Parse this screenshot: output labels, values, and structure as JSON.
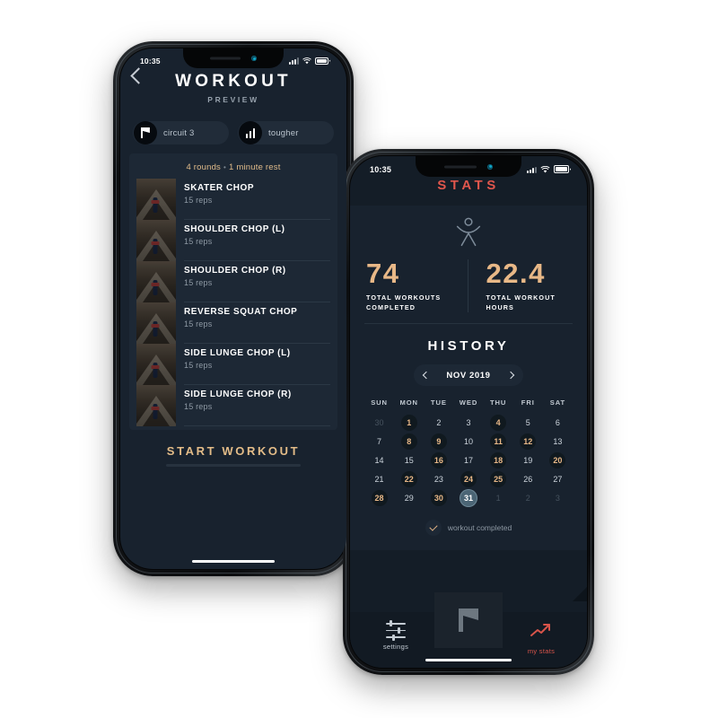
{
  "phone_workout": {
    "status_bar": {
      "time": "10:35",
      "signal_icon": "signal-bars-icon",
      "wifi_icon": "wifi-icon",
      "battery_icon": "battery-icon"
    },
    "back_icon": "back-chevron-icon",
    "title": "WORKOUT",
    "subtitle": "PREVIEW",
    "pills": [
      {
        "icon": "flag-icon",
        "label": "circuit 3"
      },
      {
        "icon": "bar-chart-icon",
        "label": "tougher"
      }
    ],
    "rounds_line": {
      "rounds": "4 rounds",
      "separator": "•",
      "rest": "1 minute rest"
    },
    "exercises": [
      {
        "name": "SKATER CHOP",
        "reps": "15 reps",
        "thumb": "exercise-thumbnail"
      },
      {
        "name": "SHOULDER CHOP (L)",
        "reps": "15 reps",
        "thumb": "exercise-thumbnail"
      },
      {
        "name": "SHOULDER CHOP (R)",
        "reps": "15 reps",
        "thumb": "exercise-thumbnail"
      },
      {
        "name": "REVERSE SQUAT CHOP",
        "reps": "15 reps",
        "thumb": "exercise-thumbnail"
      },
      {
        "name": "SIDE LUNGE CHOP (L)",
        "reps": "15 reps",
        "thumb": "exercise-thumbnail"
      },
      {
        "name": "SIDE LUNGE CHOP (R)",
        "reps": "15 reps",
        "thumb": "exercise-thumbnail"
      }
    ],
    "start_button": "START WORKOUT"
  },
  "phone_stats": {
    "status_bar": {
      "time": "10:35",
      "signal_icon": "signal-bars-icon",
      "wifi_icon": "wifi-icon",
      "battery_icon": "battery-icon"
    },
    "title": "STATS",
    "figure_icon": "stick-figure-icon",
    "stats": [
      {
        "value": "74",
        "label": "TOTAL WORKOUTS\nCOMPLETED"
      },
      {
        "value": "22.4",
        "label": "TOTAL WORKOUT\nHOURS"
      }
    ],
    "history_title": "HISTORY",
    "month_nav": {
      "prev_icon": "chevron-left-icon",
      "month": "NOV 2019",
      "next_icon": "chevron-right-icon"
    },
    "day_headers": [
      "SUN",
      "MON",
      "TUE",
      "WED",
      "THU",
      "FRI",
      "SAT"
    ],
    "calendar_rows": [
      [
        {
          "n": "30",
          "s": "dim"
        },
        {
          "n": "1",
          "s": "done"
        },
        {
          "n": "2",
          "s": ""
        },
        {
          "n": "3",
          "s": ""
        },
        {
          "n": "4",
          "s": "done"
        },
        {
          "n": "5",
          "s": ""
        },
        {
          "n": "6",
          "s": ""
        }
      ],
      [
        {
          "n": "7",
          "s": ""
        },
        {
          "n": "8",
          "s": "done"
        },
        {
          "n": "9",
          "s": "done"
        },
        {
          "n": "10",
          "s": ""
        },
        {
          "n": "11",
          "s": "done"
        },
        {
          "n": "12",
          "s": "done"
        },
        {
          "n": "13",
          "s": ""
        }
      ],
      [
        {
          "n": "14",
          "s": ""
        },
        {
          "n": "15",
          "s": ""
        },
        {
          "n": "16",
          "s": "done"
        },
        {
          "n": "17",
          "s": ""
        },
        {
          "n": "18",
          "s": "done"
        },
        {
          "n": "19",
          "s": ""
        },
        {
          "n": "20",
          "s": "done"
        }
      ],
      [
        {
          "n": "21",
          "s": ""
        },
        {
          "n": "22",
          "s": "done"
        },
        {
          "n": "23",
          "s": ""
        },
        {
          "n": "24",
          "s": "done"
        },
        {
          "n": "25",
          "s": "done"
        },
        {
          "n": "26",
          "s": ""
        },
        {
          "n": "27",
          "s": ""
        }
      ],
      [
        {
          "n": "28",
          "s": "done"
        },
        {
          "n": "29",
          "s": ""
        },
        {
          "n": "30",
          "s": "done"
        },
        {
          "n": "31",
          "s": "sel"
        },
        {
          "n": "1",
          "s": "dim"
        },
        {
          "n": "2",
          "s": "dim"
        },
        {
          "n": "3",
          "s": "dim"
        }
      ]
    ],
    "legend": {
      "icon": "check-icon",
      "label": "workout completed"
    },
    "tabbar": {
      "settings": {
        "icon": "sliders-icon",
        "label": "settings"
      },
      "center": {
        "icon": "flag-icon"
      },
      "my_stats": {
        "icon": "trending-up-icon",
        "label": "my stats"
      }
    }
  },
  "colors": {
    "accent_tan": "#e8b887",
    "accent_red": "#e0564c",
    "screen_bg": "#18222e",
    "card_bg": "#1d2835",
    "selected_day": "#4b6575"
  }
}
